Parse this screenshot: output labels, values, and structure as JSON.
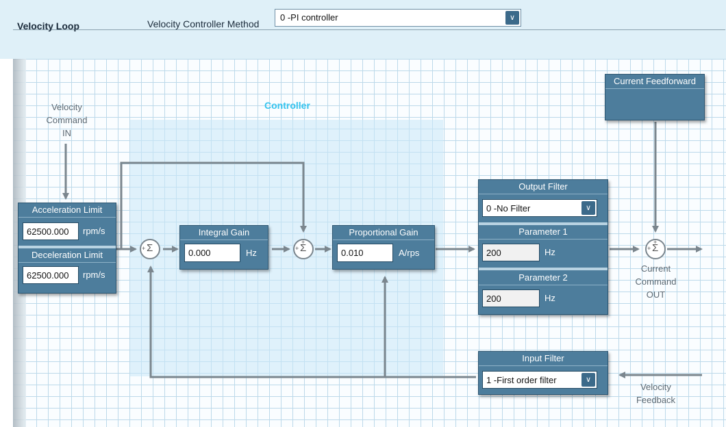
{
  "header": {
    "title": "Velocity Loop",
    "method_label": "Velocity Controller Method",
    "method_value": "0 -PI controller"
  },
  "diagram": {
    "controller_label": "Controller",
    "velocity_command": [
      "Velocity",
      "Command",
      "IN"
    ],
    "current_command": [
      "Current",
      "Command",
      "OUT"
    ],
    "velocity_feedback": [
      "Velocity",
      "Feedback"
    ],
    "sum_sign": "Σ",
    "plus": "+"
  },
  "accel": {
    "title": "Acceleration Limit",
    "value": "62500.000",
    "unit": "rpm/s"
  },
  "decel": {
    "title": "Deceleration Limit",
    "value": "62500.000",
    "unit": "rpm/s"
  },
  "integral": {
    "title": "Integral Gain",
    "value": "0.000",
    "unit": "Hz"
  },
  "proportional": {
    "title": "Proportional Gain",
    "value": "0.010",
    "unit": "A/rps"
  },
  "output_filter": {
    "title": "Output Filter",
    "value": "0 -No Filter",
    "param1_title": "Parameter 1",
    "param1_value": "200",
    "param1_unit": "Hz",
    "param2_title": "Parameter 2",
    "param2_value": "200",
    "param2_unit": "Hz"
  },
  "input_filter": {
    "title": "Input Filter",
    "value": "1  -First order filter"
  },
  "feedforward": {
    "title": "Current Feedforward"
  },
  "icons": {
    "dropdown": "chevron-down-icon"
  }
}
